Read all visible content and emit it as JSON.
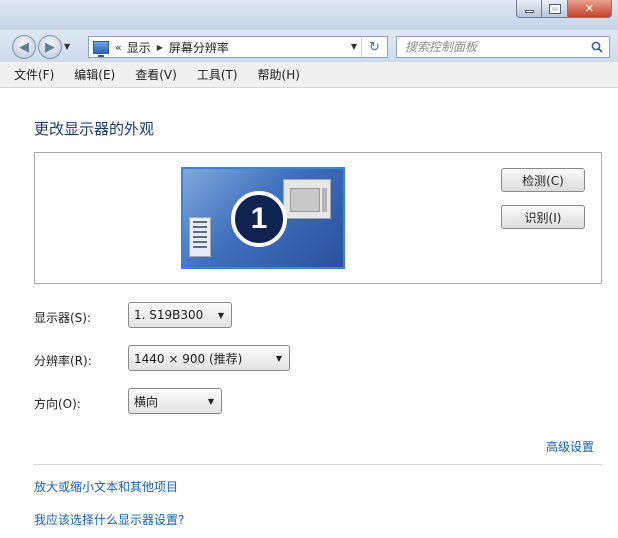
{
  "address_bar": {
    "segments": [
      "显示",
      "屏幕分辨率"
    ]
  },
  "search": {
    "placeholder": "搜索控制面板"
  },
  "menu": [
    {
      "label": "文件(F)"
    },
    {
      "label": "编辑(E)"
    },
    {
      "label": "查看(V)"
    },
    {
      "label": "工具(T)"
    },
    {
      "label": "帮助(H)"
    }
  ],
  "main": {
    "title": "更改显示器的外观",
    "monitor_number": "1",
    "detect_label": "检测(C)",
    "identify_label": "识别(I)",
    "display_label": "显示器(S):",
    "display_value": "1. S19B300",
    "resolution_label": "分辨率(R):",
    "resolution_value": "1440 × 900 (推荐)",
    "orientation_label": "方向(O):",
    "orientation_value": "横向",
    "advanced_link": "高级设置",
    "link_text_size": "放大或缩小文本和其他项目",
    "link_help": "我应该选择什么显示器设置?"
  },
  "colors": {
    "title_text": "#1e3b70",
    "link": "#1a5fb4",
    "monitor_blue": "#3f6fbd"
  }
}
